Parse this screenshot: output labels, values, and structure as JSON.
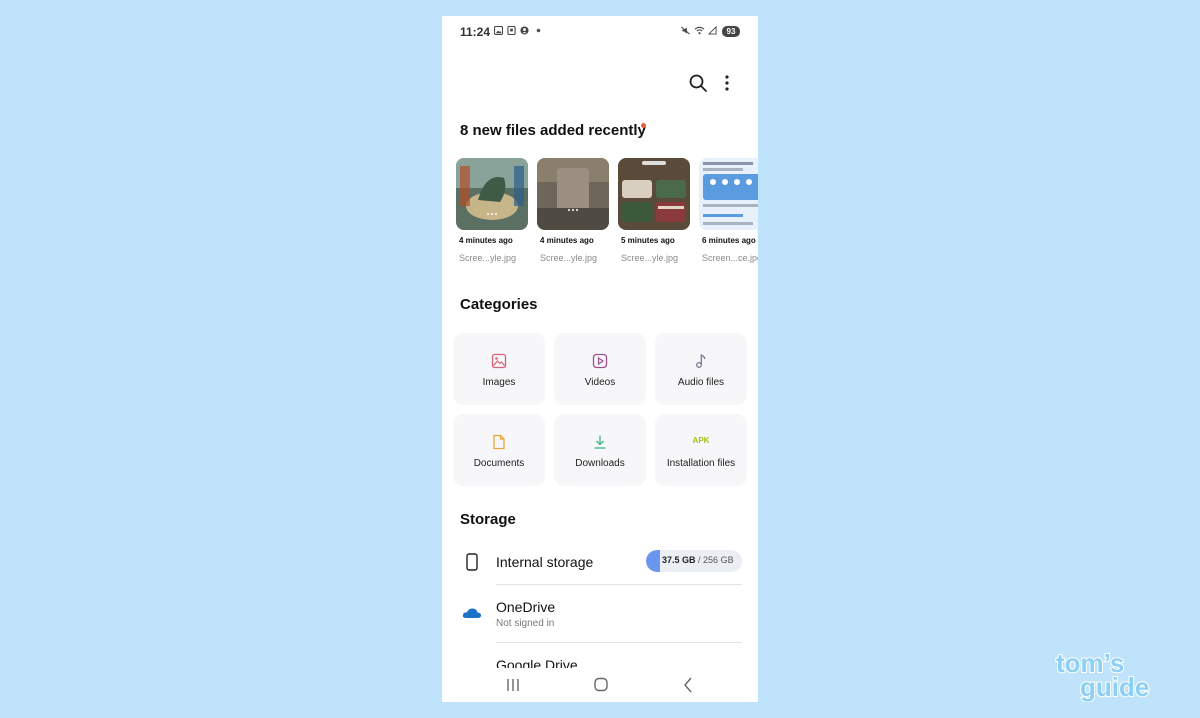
{
  "status_bar": {
    "time": "11:24",
    "battery": "93",
    "icons": [
      "gallery-icon",
      "sim-icon",
      "account-icon",
      "notification-dot-icon",
      "mute-icon",
      "wifi-icon",
      "signal-icon"
    ]
  },
  "toolbar": {
    "search_icon": "search-icon",
    "more_icon": "more-vert-icon"
  },
  "recent": {
    "title": "8 new files added recently",
    "items": [
      {
        "time": "4 minutes ago",
        "name": "Scree...yle.jpg"
      },
      {
        "time": "4 minutes ago",
        "name": "Scree...yle.jpg"
      },
      {
        "time": "5 minutes ago",
        "name": "Scree...yle.jpg"
      },
      {
        "time": "6 minutes ago",
        "name": "Screen...ce.jpg"
      }
    ]
  },
  "categories": {
    "title": "Categories",
    "items": [
      {
        "label": "Images",
        "icon": "image-icon",
        "color": "#d9627a"
      },
      {
        "label": "Videos",
        "icon": "video-icon",
        "color": "#a0508f"
      },
      {
        "label": "Audio files",
        "icon": "music-note-icon",
        "color": "#7a7a9a"
      },
      {
        "label": "Documents",
        "icon": "document-icon",
        "color": "#e6a63a"
      },
      {
        "label": "Downloads",
        "icon": "download-icon",
        "color": "#3fb38a"
      },
      {
        "label": "Installation files",
        "icon": "apk-icon",
        "icon_text": "APK",
        "color": "#a5c21a"
      }
    ]
  },
  "storage": {
    "title": "Storage",
    "internal": {
      "label": "Internal storage",
      "used": "37.5 GB",
      "total": "/ 256 GB",
      "used_fraction": 0.146,
      "icon": "phone-icon"
    },
    "onedrive": {
      "label": "OneDrive",
      "sub": "Not signed in",
      "icon": "onedrive-icon",
      "color": "#1a73c9"
    },
    "google_drive": {
      "label": "Google Drive"
    }
  },
  "nav": {
    "recents": "recents-icon",
    "home": "home-icon",
    "back": "back-icon"
  },
  "watermark": "tom's guide",
  "colors": {
    "background": "#bfe3fa",
    "accent": "#6b96ee"
  }
}
